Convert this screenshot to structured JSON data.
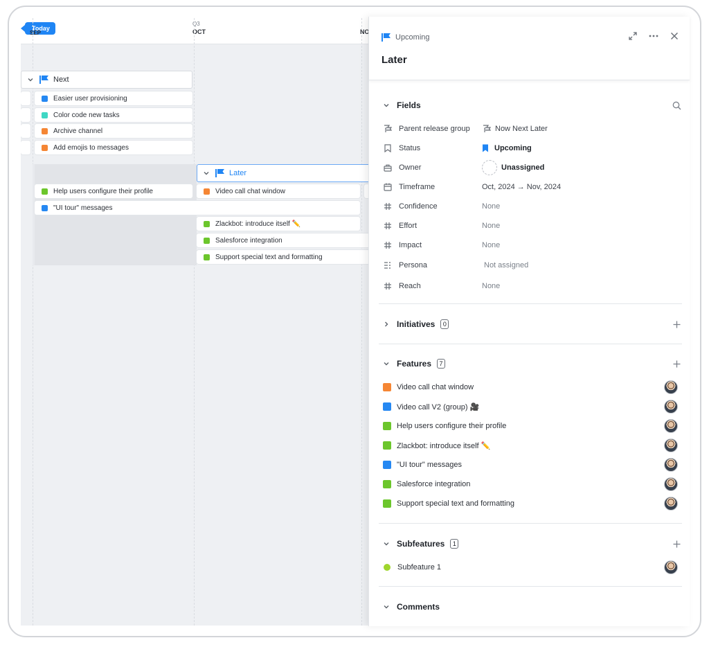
{
  "timeline": {
    "today_label": "Today",
    "quarter_label": "Q3",
    "month_prev": "SEP",
    "month_oct": "OCT",
    "month_nov": "NO",
    "groups": {
      "next": {
        "title": "Next",
        "items": [
          {
            "label": "Easier user provisioning",
            "color": "#2588f2"
          },
          {
            "label": "Color code new tasks",
            "color": "#3fd7c4"
          },
          {
            "label": "Archive channel",
            "color": "#f58634"
          },
          {
            "label": "Add emojis to messages",
            "color": "#f58634"
          }
        ]
      },
      "later": {
        "title": "Later",
        "left_items": [
          {
            "label": "Help users configure their profile",
            "color": "#6cc62c"
          },
          {
            "label": "\"UI tour\" messages",
            "color": "#2588f2"
          }
        ],
        "right_items": [
          {
            "label": "Video call chat window",
            "color": "#f58634"
          },
          {
            "label": "Zlackbot: introduce itself ✏️",
            "color": "#6cc62c"
          },
          {
            "label": "Salesforce integration",
            "color": "#6cc62c"
          },
          {
            "label": "Support special text and formatting",
            "color": "#6cc62c"
          }
        ]
      }
    }
  },
  "panel": {
    "breadcrumb": "Upcoming",
    "title": "Later",
    "fields_section": {
      "title": "Fields",
      "rows": [
        {
          "label": "Parent release group",
          "value": "Now Next Later",
          "icon": "release-group-icon"
        },
        {
          "label": "Status",
          "value": "Upcoming",
          "icon": "bookmark-icon"
        },
        {
          "label": "Owner",
          "value": "Unassigned",
          "icon": "briefcase-icon"
        },
        {
          "label": "Timeframe",
          "value": "Oct, 2024 → Nov, 2024",
          "icon": "calendar-icon"
        },
        {
          "label": "Confidence",
          "value": "None",
          "icon": "hash-icon"
        },
        {
          "label": "Effort",
          "value": "None",
          "icon": "hash-icon"
        },
        {
          "label": "Impact",
          "value": "None",
          "icon": "hash-icon"
        },
        {
          "label": "Persona",
          "value": "Not assigned",
          "icon": "list-icon"
        },
        {
          "label": "Reach",
          "value": "None",
          "icon": "hash-icon"
        }
      ]
    },
    "initiatives": {
      "title": "Initiatives",
      "count": "0"
    },
    "features": {
      "title": "Features",
      "count": "7",
      "items": [
        {
          "label": "Video call chat window",
          "color": "#f58634"
        },
        {
          "label": "Video call V2 (group) 🎥",
          "color": "#2588f2"
        },
        {
          "label": "Help users configure their profile",
          "color": "#6cc62c"
        },
        {
          "label": "Zlackbot: introduce itself ✏️",
          "color": "#6cc62c"
        },
        {
          "label": "\"UI tour\" messages",
          "color": "#2588f2"
        },
        {
          "label": "Salesforce integration",
          "color": "#6cc62c"
        },
        {
          "label": "Support special text and formatting",
          "color": "#6cc62c"
        }
      ]
    },
    "subfeatures": {
      "title": "Subfeatures",
      "count": "1",
      "items": [
        {
          "label": "Subfeature 1",
          "color": "#9fd62d"
        }
      ]
    },
    "comments": {
      "title": "Comments"
    }
  }
}
